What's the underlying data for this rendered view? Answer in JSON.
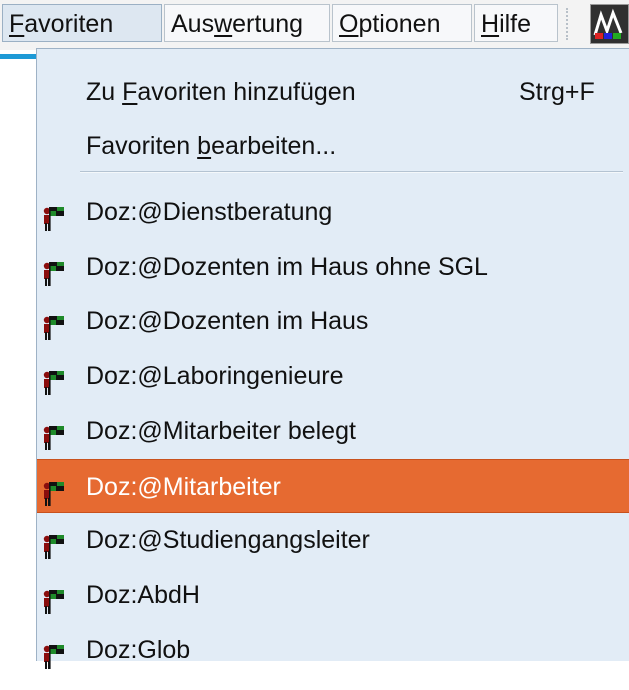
{
  "menubar": {
    "items": [
      {
        "pre": "",
        "u": "F",
        "post": "avoriten"
      },
      {
        "pre": "Aus",
        "u": "w",
        "post": "ertung"
      },
      {
        "pre": "",
        "u": "O",
        "post": "ptionen"
      },
      {
        "pre": "",
        "u": "H",
        "post": "ilfe"
      }
    ],
    "app_icon": "app-toolbar-icon"
  },
  "menu": {
    "actions": [
      {
        "pre": "Zu ",
        "u": "F",
        "post": "avoriten hinzufügen",
        "shortcut": "Strg+F"
      },
      {
        "pre": "Favoriten ",
        "u": "b",
        "post": "earbeiten...",
        "shortcut": ""
      }
    ],
    "favorites": [
      {
        "label": "Doz:@Dienstberatung",
        "selected": false
      },
      {
        "label": "Doz:@Dozenten im Haus ohne SGL",
        "selected": false
      },
      {
        "label": "Doz:@Dozenten im Haus",
        "selected": false
      },
      {
        "label": "Doz:@Laboringenieure",
        "selected": false
      },
      {
        "label": "Doz:@Mitarbeiter belegt",
        "selected": false
      },
      {
        "label": "Doz:@Mitarbeiter",
        "selected": true
      },
      {
        "label": "Doz:@Studiengangsleiter",
        "selected": false
      },
      {
        "label": "Doz:AbdH",
        "selected": false
      },
      {
        "label": "Doz:Glob",
        "selected": false
      }
    ],
    "item_icon": "flag-person-icon"
  },
  "colors": {
    "menu_bg": "#e2ecf6",
    "selected_bg": "#e66a31",
    "accent": "#1e9ad6",
    "icon_green": "#1f8a2a"
  }
}
